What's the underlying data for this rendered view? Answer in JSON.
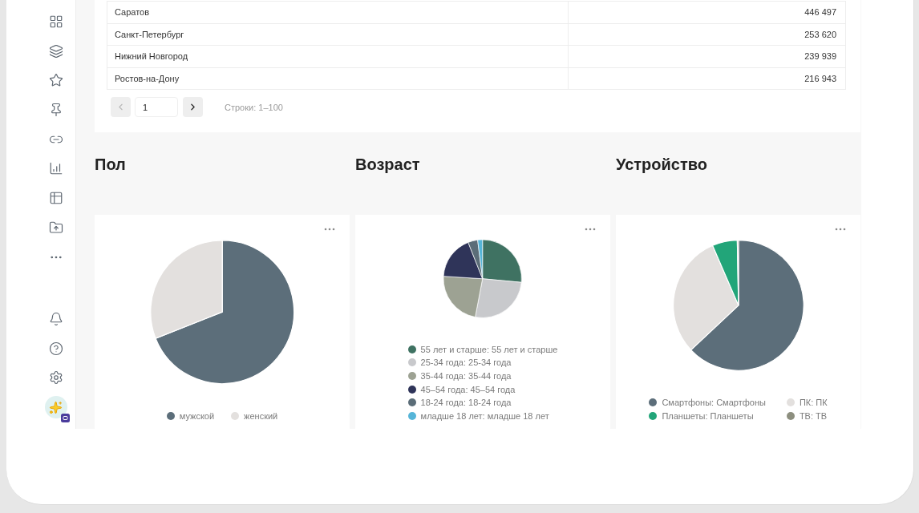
{
  "table": {
    "rows": [
      {
        "cells": [
          "Саратов",
          "446 497"
        ]
      },
      {
        "cells": [
          "Санкт-Петербург",
          "253 620"
        ]
      },
      {
        "cells": [
          "Нижний Новгород",
          "239 939"
        ]
      },
      {
        "cells": [
          "Ростов-на-Дону",
          "216 943"
        ]
      }
    ],
    "pagination": {
      "prev": {
        "disabled": true
      },
      "page": "1",
      "next": {
        "disabled": false
      },
      "range": "Строки: 1–100"
    }
  },
  "sections": [
    {
      "title": "Пол",
      "chart_data": {
        "type": "pie",
        "values": [
          69,
          31
        ]
      },
      "legend": {
        "kind": "row",
        "items": [
          {
            "label": "мужской",
            "color": "#5c6e7a"
          },
          {
            "label": "женский",
            "color": "#e3e0de"
          }
        ]
      }
    },
    {
      "title": "Возраст",
      "chart_data": {
        "type": "pie",
        "values": [
          26.5,
          26.5,
          23,
          18,
          4,
          2
        ]
      },
      "legend": {
        "kind": "column",
        "items": [
          {
            "label": "55 лет и старше: 55 лет и старше",
            "color": "#3f7262"
          },
          {
            "label": "25-34 года: 25-34 года",
            "color": "#c8c9cc"
          },
          {
            "label": "35-44 года: 35-44 года",
            "color": "#9da293"
          },
          {
            "label": "45–54 года: 45–54 года",
            "color": "#2f3459"
          },
          {
            "label": "18-24 года: 18-24 года",
            "color": "#5b6d78"
          },
          {
            "label": "младше 18 лет: младше 18 лет",
            "color": "#56b5d8"
          }
        ]
      }
    },
    {
      "title": "Устройство",
      "chart_data": {
        "type": "pie",
        "values": [
          63,
          30.5,
          6.2,
          0.3
        ]
      },
      "legend": {
        "kind": "grid",
        "items": [
          {
            "label": "Смартфоны: Смартфоны",
            "color": "#5c6e7a"
          },
          {
            "label": "ПК: ПК",
            "color": "#e3e0de"
          },
          {
            "label": "Планшеты: Планшеты",
            "color": "#22a579"
          },
          {
            "label": "ТВ: ТВ",
            "color": "#8d8f7f"
          }
        ]
      }
    }
  ]
}
